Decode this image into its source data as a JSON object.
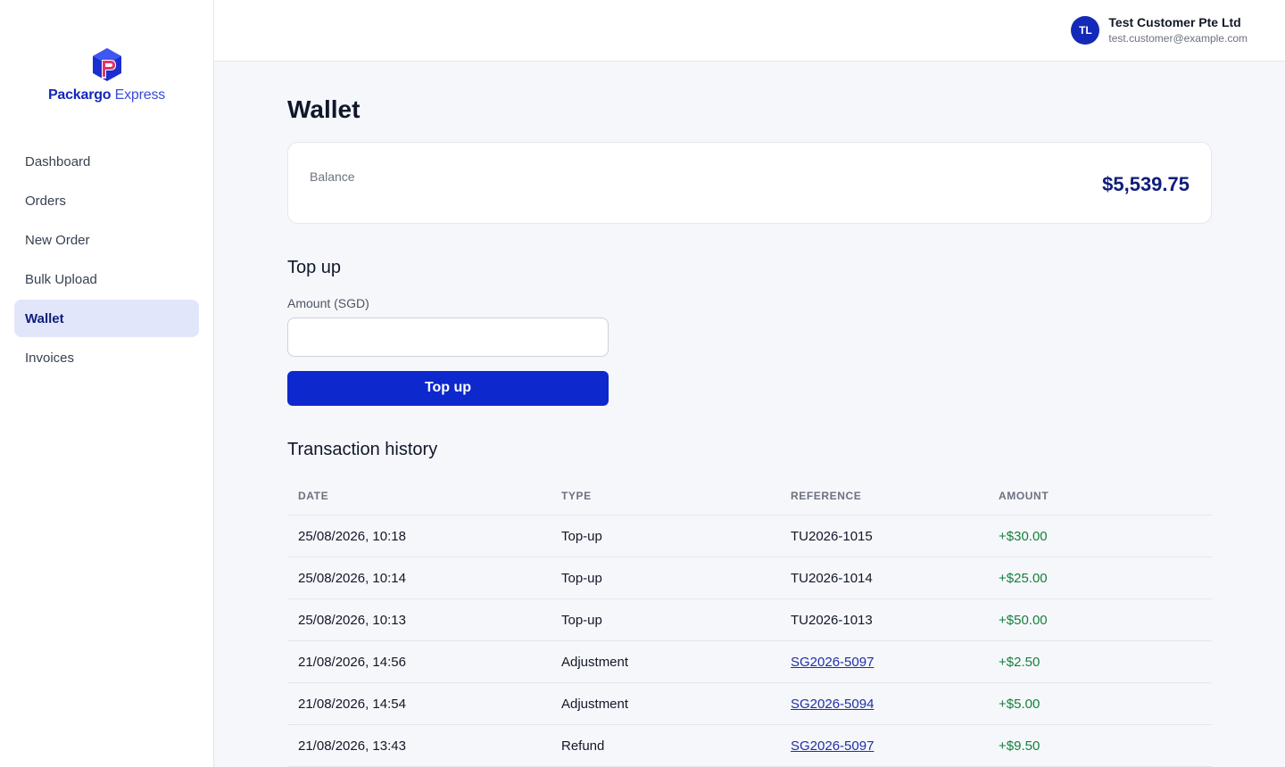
{
  "brand": {
    "name_bold": "Packargo",
    "name_light": "Express"
  },
  "sidebar": {
    "items": [
      {
        "label": "Dashboard",
        "active": false
      },
      {
        "label": "Orders",
        "active": false
      },
      {
        "label": "New Order",
        "active": false
      },
      {
        "label": "Bulk Upload",
        "active": false
      },
      {
        "label": "Wallet",
        "active": true
      },
      {
        "label": "Invoices",
        "active": false
      }
    ]
  },
  "user": {
    "initials": "TL",
    "name": "Test Customer Pte Ltd",
    "email": "test.customer@example.com"
  },
  "page": {
    "title": "Wallet"
  },
  "balance": {
    "label": "Balance",
    "value": "$5,539.75"
  },
  "topup": {
    "title": "Top up",
    "amount_label": "Amount (SGD)",
    "amount_value": "",
    "button_label": "Top up"
  },
  "history": {
    "title": "Transaction history",
    "columns": [
      "DATE",
      "TYPE",
      "REFERENCE",
      "AMOUNT"
    ],
    "rows": [
      {
        "date": "25/08/2026, 10:18",
        "type": "Top-up",
        "reference": "TU2026-1015",
        "reference_link": false,
        "amount": "+$30.00"
      },
      {
        "date": "25/08/2026, 10:14",
        "type": "Top-up",
        "reference": "TU2026-1014",
        "reference_link": false,
        "amount": "+$25.00"
      },
      {
        "date": "25/08/2026, 10:13",
        "type": "Top-up",
        "reference": "TU2026-1013",
        "reference_link": false,
        "amount": "+$50.00"
      },
      {
        "date": "21/08/2026, 14:56",
        "type": "Adjustment",
        "reference": "SG2026-5097",
        "reference_link": true,
        "amount": "+$2.50"
      },
      {
        "date": "21/08/2026, 14:54",
        "type": "Adjustment",
        "reference": "SG2026-5094",
        "reference_link": true,
        "amount": "+$5.00"
      },
      {
        "date": "21/08/2026, 13:43",
        "type": "Refund",
        "reference": "SG2026-5097",
        "reference_link": true,
        "amount": "+$9.50"
      }
    ]
  },
  "colors": {
    "accent": "#0d28cc",
    "brand_dark": "#0f1d7a",
    "positive_amount": "#15803d",
    "active_nav_bg": "#e2e6fb"
  }
}
